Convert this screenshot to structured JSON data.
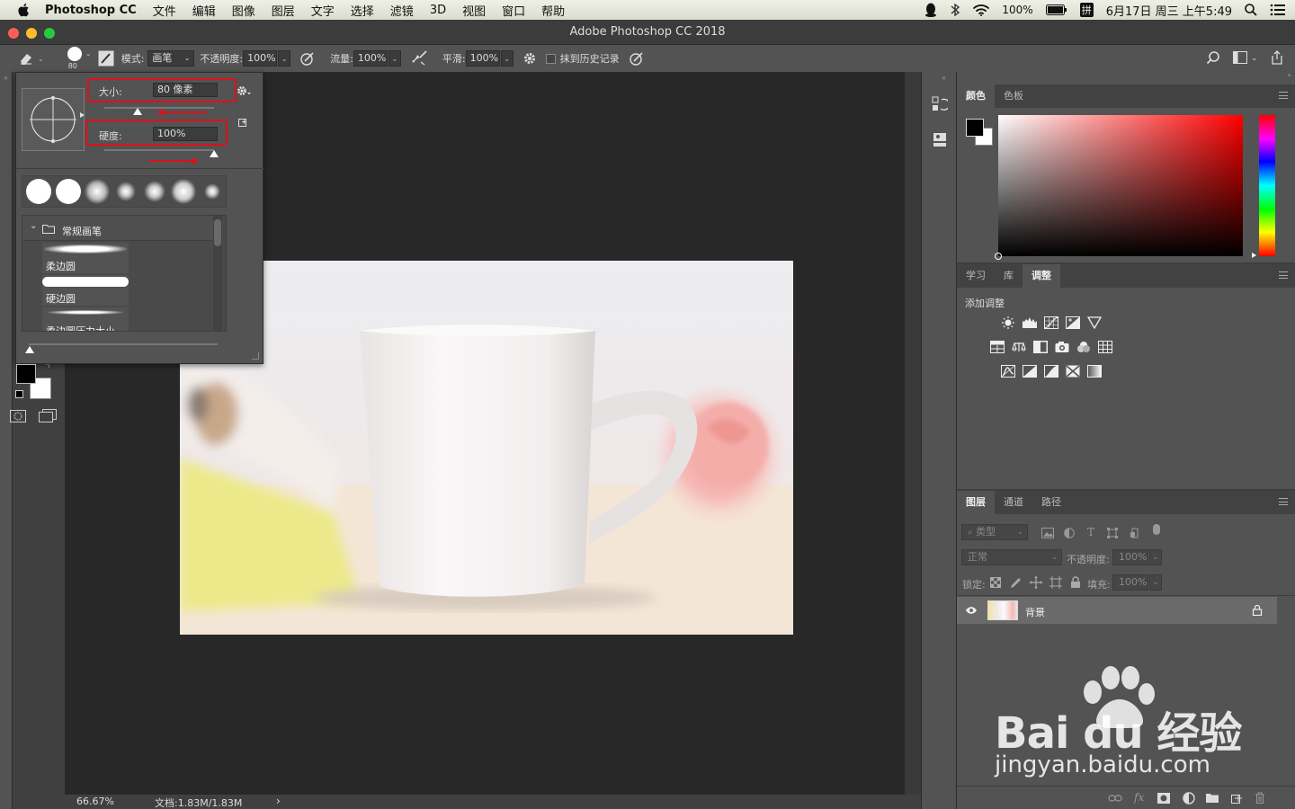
{
  "menubar": {
    "app_name": "Photoshop CC",
    "items": [
      "文件",
      "编辑",
      "图像",
      "图层",
      "文字",
      "选择",
      "滤镜",
      "3D",
      "视图",
      "窗口",
      "帮助"
    ],
    "battery": "100%",
    "input_method": "拼",
    "clock": "6月17日 周三 上午5:49"
  },
  "window": {
    "title": "Adobe Photoshop CC 2018"
  },
  "options_bar": {
    "brush_size_preview": "80",
    "mode_label": "模式:",
    "mode_value": "画笔",
    "opacity_label": "不透明度:",
    "opacity_value": "100%",
    "flow_label": "流量:",
    "flow_value": "100%",
    "smoothing_label": "平滑:",
    "smoothing_value": "100%",
    "erase_history_label": "抹到历史记录"
  },
  "brush_panel": {
    "size_label": "大小:",
    "size_value": "80 像素",
    "size_slider": 0.3,
    "hardness_label": "硬度:",
    "hardness_value": "100%",
    "hardness_slider": 1.0,
    "folder_label": "常规画笔",
    "brushes": [
      "柔边圆",
      "硬边圆",
      "柔边圆压力大小"
    ]
  },
  "status_bar": {
    "zoom": "66.67%",
    "doc_info": "文档:1.83M/1.83M",
    "arrow": "›"
  },
  "color_panel": {
    "tabs": [
      "颜色",
      "色板"
    ],
    "active_tab": "颜色",
    "hue_color": "#ff0000"
  },
  "adjust_panel": {
    "tabs": [
      "学习",
      "库",
      "调整"
    ],
    "active_tab": "调整",
    "add_label": "添加调整"
  },
  "layers_panel": {
    "tabs": [
      "图层",
      "通道",
      "路径"
    ],
    "active_tab": "图层",
    "filter_label": "类型",
    "blend_mode": "正常",
    "opacity_label": "不透明度:",
    "opacity_value": "100%",
    "lock_label": "锁定:",
    "fill_label": "填充:",
    "fill_value": "100%",
    "layers": [
      {
        "name": "背景",
        "visible": true,
        "locked": true
      }
    ]
  },
  "watermark": {
    "brand": "Bai du 经验",
    "url": "jingyan.baidu.com"
  }
}
